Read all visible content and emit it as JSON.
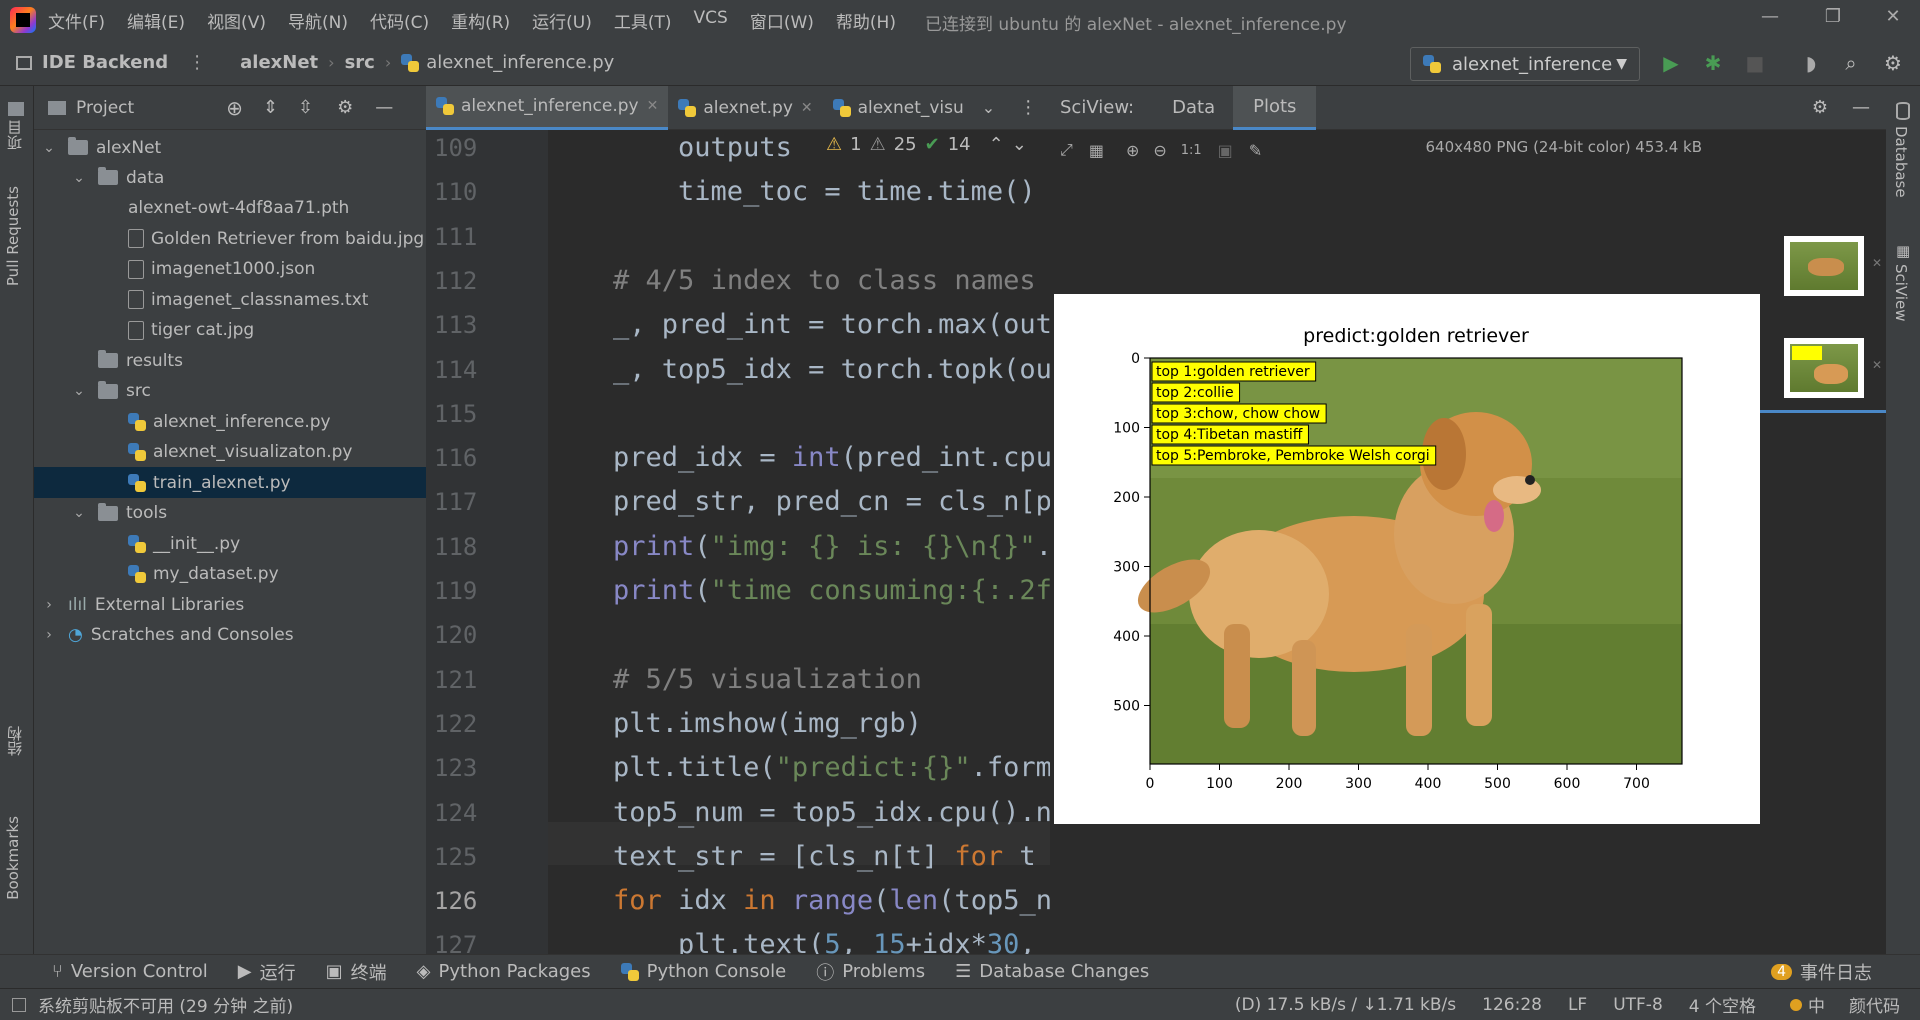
{
  "menu": [
    "文件(F)",
    "编辑(E)",
    "视图(V)",
    "导航(N)",
    "代码(C)",
    "重构(R)",
    "运行(U)",
    "工具(T)",
    "VCS",
    "窗口(W)",
    "帮助(H)"
  ],
  "window_title": "已连接到 ubuntu 的 alexNet - alexnet_inference.py",
  "nav": {
    "backend": "IDE Backend",
    "project": "alexNet",
    "folder": "src",
    "file": "alexnet_inference.py"
  },
  "run_config": "alexnet_inference",
  "left_strip": {
    "project": "项目",
    "pull_requests": "Pull Requests",
    "structure": "结构",
    "bookmarks": "Bookmarks"
  },
  "project_panel": {
    "title": "Project",
    "tree": [
      {
        "label": "alexNet",
        "type": "folder",
        "depth": 0,
        "arrow": "⌄"
      },
      {
        "label": "data",
        "type": "folder",
        "depth": 1,
        "arrow": "⌄"
      },
      {
        "label": "alexnet-owt-4df8aa71.pth",
        "type": "none",
        "depth": 2
      },
      {
        "label": "Golden Retriever from baidu.jpg",
        "type": "file",
        "depth": 2
      },
      {
        "label": "imagenet1000.json",
        "type": "file",
        "depth": 2
      },
      {
        "label": "imagenet_classnames.txt",
        "type": "file",
        "depth": 2
      },
      {
        "label": "tiger cat.jpg",
        "type": "file",
        "depth": 2
      },
      {
        "label": "results",
        "type": "folder",
        "depth": 1
      },
      {
        "label": "src",
        "type": "folder",
        "depth": 1,
        "arrow": "⌄"
      },
      {
        "label": "alexnet_inference.py",
        "type": "py",
        "depth": 2
      },
      {
        "label": "alexnet_visualizaton.py",
        "type": "py",
        "depth": 2
      },
      {
        "label": "train_alexnet.py",
        "type": "py",
        "depth": 2,
        "selected": true
      },
      {
        "label": "tools",
        "type": "folder",
        "depth": 1,
        "arrow": "⌄"
      },
      {
        "label": "__init__.py",
        "type": "py",
        "depth": 2
      },
      {
        "label": "my_dataset.py",
        "type": "py",
        "depth": 2
      },
      {
        "label": "External Libraries",
        "type": "lib",
        "depth": 0,
        "arrow": "›"
      },
      {
        "label": "Scratches and Consoles",
        "type": "scratch",
        "depth": 0,
        "arrow": "›"
      }
    ]
  },
  "editor": {
    "tabs": [
      {
        "label": "alexnet_inference.py",
        "active": true
      },
      {
        "label": "alexnet.py",
        "active": false
      },
      {
        "label": "alexnet_visu",
        "active": false
      }
    ],
    "inspections": {
      "warn1": "1",
      "warn2": "25",
      "ok": "14"
    },
    "lines": [
      {
        "n": "109",
        "html": "        outputs "
      },
      {
        "n": "110",
        "html": "        time_toc = time.time()"
      },
      {
        "n": "111",
        "html": ""
      },
      {
        "n": "112",
        "html": "    <span class='cm'># 4/5 index to class names</span>"
      },
      {
        "n": "113",
        "html": "    _, pred_int = torch.max(out"
      },
      {
        "n": "114",
        "html": "    _, top5_idx = torch.topk(ou"
      },
      {
        "n": "115",
        "html": ""
      },
      {
        "n": "116",
        "html": "    pred_idx = <span class='fn'>int</span>(pred_int.cpu"
      },
      {
        "n": "117",
        "html": "    pred_str, pred_cn = cls_n[p"
      },
      {
        "n": "118",
        "html": "    <span class='fn'>print</span>(<span class='str'>\"img: {} is: {}\\n{}\"</span>."
      },
      {
        "n": "119",
        "html": "    <span class='fn'>print</span>(<span class='str'>\"time consuming:{:.2f</span>"
      },
      {
        "n": "120",
        "html": ""
      },
      {
        "n": "121",
        "html": "    <span class='cm'># 5/5 visualization</span>"
      },
      {
        "n": "122",
        "html": "    plt.imshow(img_rgb)"
      },
      {
        "n": "123",
        "html": "    plt.title(<span class='str'>\"predict:{}\"</span>.form"
      },
      {
        "n": "124",
        "html": "    top5_num = top5_idx.cpu().n"
      },
      {
        "n": "125",
        "html": "    text_str = [cls_n[t] <span class='kw'>for</span> t"
      },
      {
        "n": "126",
        "html": "    <span class='kw'>for</span> idx <span class='kw'>in</span> <span class='fn'>range</span>(<span class='fn'>len</span>(top5_n"
      },
      {
        "n": "127",
        "html": "        plt.text(<span class='num'>5</span>, <span class='num'>15</span>+idx*<span class='num'>30</span>,"
      }
    ]
  },
  "sciview": {
    "label": "SciView:",
    "tabs": [
      "Data",
      "Plots"
    ],
    "image_info": "640x480 PNG (24-bit color) 453.4 kB",
    "zoom_1to1": "1:1"
  },
  "plot": {
    "title": "predict:golden retriever",
    "labels": [
      "top 1:golden retriever",
      "top 2:collie",
      "top 3:chow, chow chow",
      "top 4:Tibetan mastiff",
      "top 5:Pembroke, Pembroke Welsh corgi"
    ],
    "yticks": [
      "0",
      "100",
      "200",
      "300",
      "400",
      "500"
    ],
    "xticks": [
      "0",
      "100",
      "200",
      "300",
      "400",
      "500",
      "600",
      "700"
    ]
  },
  "right_strip": {
    "database": "Database",
    "sciview": "SciView"
  },
  "bottom_tabs": [
    "Version Control",
    "运行",
    "终端",
    "Python Packages",
    "Python Console",
    "Problems",
    "Database Changes"
  ],
  "event_log": {
    "count": "4",
    "label": "事件日志"
  },
  "status": {
    "message": "系统剪贴板不可用 (29 分钟 之前)",
    "network": "(D) 17.5 kB/s / ↓1.71 kB/s",
    "position": "126:28",
    "line_sep": "LF",
    "encoding": "UTF-8",
    "indent": "4 个空格",
    "ime": "中",
    "extra": "颜代码"
  },
  "colors": {
    "accent": "#4a88c7",
    "bg_editor": "#2b2b2b",
    "bg_panel": "#3c3f41",
    "selection": "#0d293e"
  }
}
